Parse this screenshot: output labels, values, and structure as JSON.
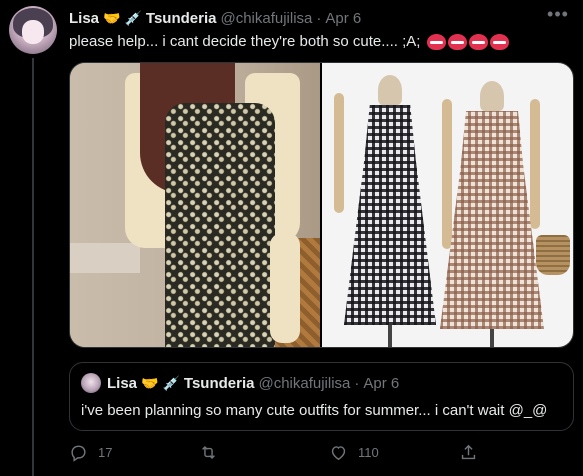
{
  "tweet": {
    "author": {
      "display_name": "Lisa",
      "name_emojis": [
        "🤝",
        "💉"
      ],
      "badge_text": "Tsunderia",
      "handle": "@chikafujilisa",
      "separator": "·",
      "time": "Apr 6"
    },
    "more_icon": "more-horizontal-icon",
    "text": "please help... i cant decide they're both so cute.... ;A; ",
    "heart_emoji_count": 4,
    "heart_color": "#e23150",
    "media": [
      {
        "description_icon": "photo",
        "name": "media-photo-left"
      },
      {
        "description_icon": "photo",
        "name": "media-photo-right"
      }
    ]
  },
  "quote": {
    "author": {
      "display_name": "Lisa",
      "name_emojis": [
        "🤝",
        "💉"
      ],
      "badge_text": "Tsunderia",
      "handle": "@chikafujilisa",
      "separator": "·",
      "time": "Apr 6"
    },
    "text": "i've been planning so many cute outfits for summer... i can't wait @_@"
  },
  "actions": {
    "reply_count": "17",
    "retweet_count": "",
    "like_count": "110",
    "share_count": ""
  },
  "colors": {
    "background": "#000000",
    "text_primary": "#e7e9ea",
    "text_secondary": "#71767b",
    "border": "#2f3336"
  }
}
